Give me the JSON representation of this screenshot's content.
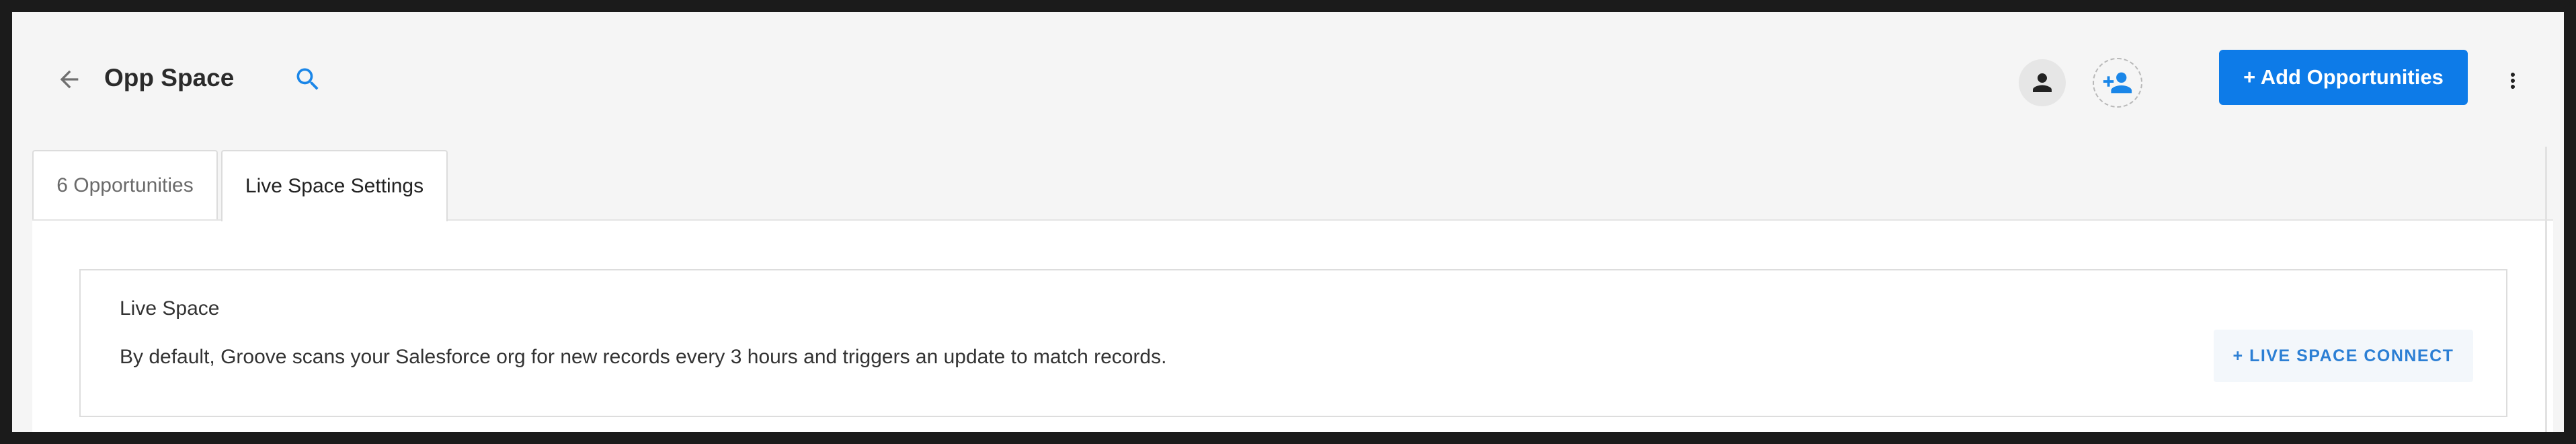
{
  "header": {
    "title": "Opp Space",
    "add_button_label": "+ Add Opportunities",
    "icons": {
      "back": "arrow-left-icon",
      "search": "search-icon",
      "avatar": "person-icon",
      "add_user": "person-add-icon",
      "more": "more-vertical-icon"
    }
  },
  "tabs": [
    {
      "label": "6 Opportunities",
      "active": false
    },
    {
      "label": "Live Space Settings",
      "active": true
    }
  ],
  "live_space": {
    "title": "Live Space",
    "description": "By default, Groove scans your Salesforce org for new records every 3 hours and triggers an update to match records.",
    "connect_button_label": "+ LIVE SPACE CONNECT"
  },
  "colors": {
    "accent": "#0d7be8",
    "connect_text": "#2c7fd4",
    "background": "#f5f5f5"
  }
}
